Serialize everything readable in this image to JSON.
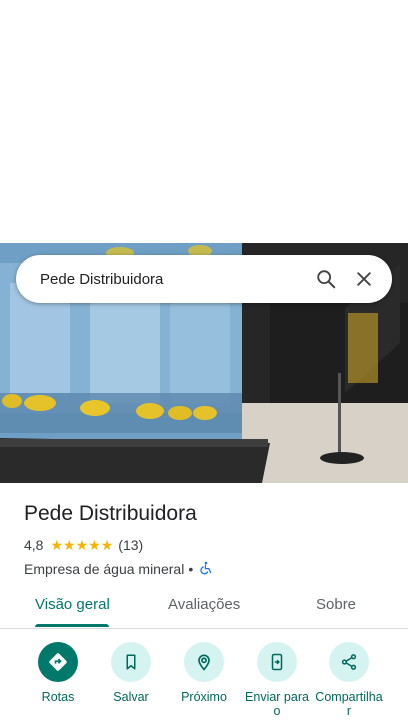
{
  "search": {
    "query": "Pede Distribuidora"
  },
  "place": {
    "name": "Pede Distribuidora",
    "rating": "4,8",
    "reviews": "(13)",
    "stars": 5,
    "category": "Empresa de água mineral",
    "separator": "•"
  },
  "tabs": [
    {
      "label": "Visão geral",
      "active": true
    },
    {
      "label": "Avaliações",
      "active": false
    },
    {
      "label": "Sobre",
      "active": false
    }
  ],
  "actions": [
    {
      "label": "Rotas",
      "icon": "directions-icon"
    },
    {
      "label": "Salvar",
      "icon": "bookmark-icon"
    },
    {
      "label": "Próximo",
      "icon": "nearby-icon"
    },
    {
      "label": "Enviar para o",
      "icon": "send-to-phone-icon"
    },
    {
      "label": "Compartilhar",
      "icon": "share-icon"
    }
  ],
  "colors": {
    "accent": "#00796b",
    "star": "#f5b400",
    "chip_bg": "#d5f3f1"
  }
}
